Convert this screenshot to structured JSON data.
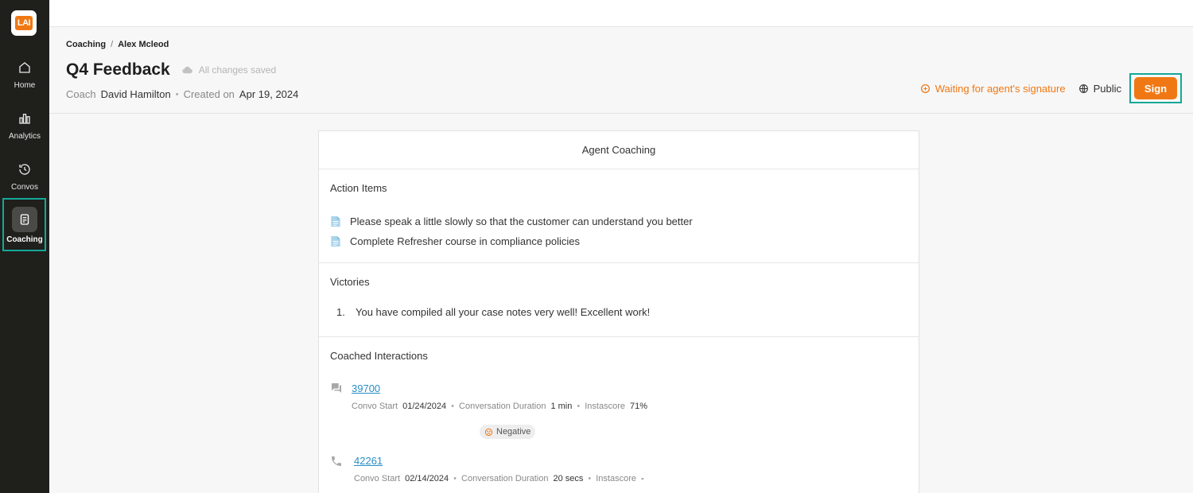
{
  "app": {
    "logo_text": "LAI"
  },
  "sidebar": {
    "items": [
      {
        "label": "Home",
        "icon": "home-icon"
      },
      {
        "label": "Analytics",
        "icon": "bar-chart-icon"
      },
      {
        "label": "Convos",
        "icon": "history-icon"
      },
      {
        "label": "Coaching",
        "icon": "document-icon",
        "active": true
      }
    ]
  },
  "breadcrumb": {
    "parent": "Coaching",
    "separator": "/",
    "current": "Alex Mcleod"
  },
  "header": {
    "title": "Q4 Feedback",
    "save_status": "All changes saved",
    "coach_label": "Coach",
    "coach_name": "David Hamilton",
    "created_label": "Created on",
    "created_date": "Apr 19, 2024",
    "status": "Waiting for agent's signature",
    "visibility": "Public",
    "sign_label": "Sign"
  },
  "colors": {
    "accent": "#f07814",
    "highlight": "#14a898",
    "link": "#2a8fc4",
    "sidebar_bg": "#1f1f1c"
  },
  "card": {
    "title": "Agent Coaching",
    "action_items": {
      "title": "Action Items",
      "items": [
        "Please speak a little slowly so that the customer can understand you better",
        "Complete Refresher course in compliance policies"
      ]
    },
    "victories": {
      "title": "Victories",
      "items": [
        {
          "num": "1.",
          "text": "You have compiled all your case notes very well! Excellent work!"
        }
      ]
    },
    "interactions": {
      "title": "Coached Interactions",
      "list": [
        {
          "id": "39700",
          "icon": "chat-icon",
          "start_label": "Convo Start",
          "start": "01/24/2024",
          "duration_label": "Conversation Duration",
          "duration": "1 min",
          "score_label": "Instascore",
          "score": "71%",
          "sentiment": "Negative"
        },
        {
          "id": "42261",
          "icon": "phone-icon",
          "start_label": "Convo Start",
          "start": "02/14/2024",
          "duration_label": "Conversation Duration",
          "duration": "20 secs",
          "score_label": "Instascore",
          "score": "-"
        }
      ]
    }
  }
}
